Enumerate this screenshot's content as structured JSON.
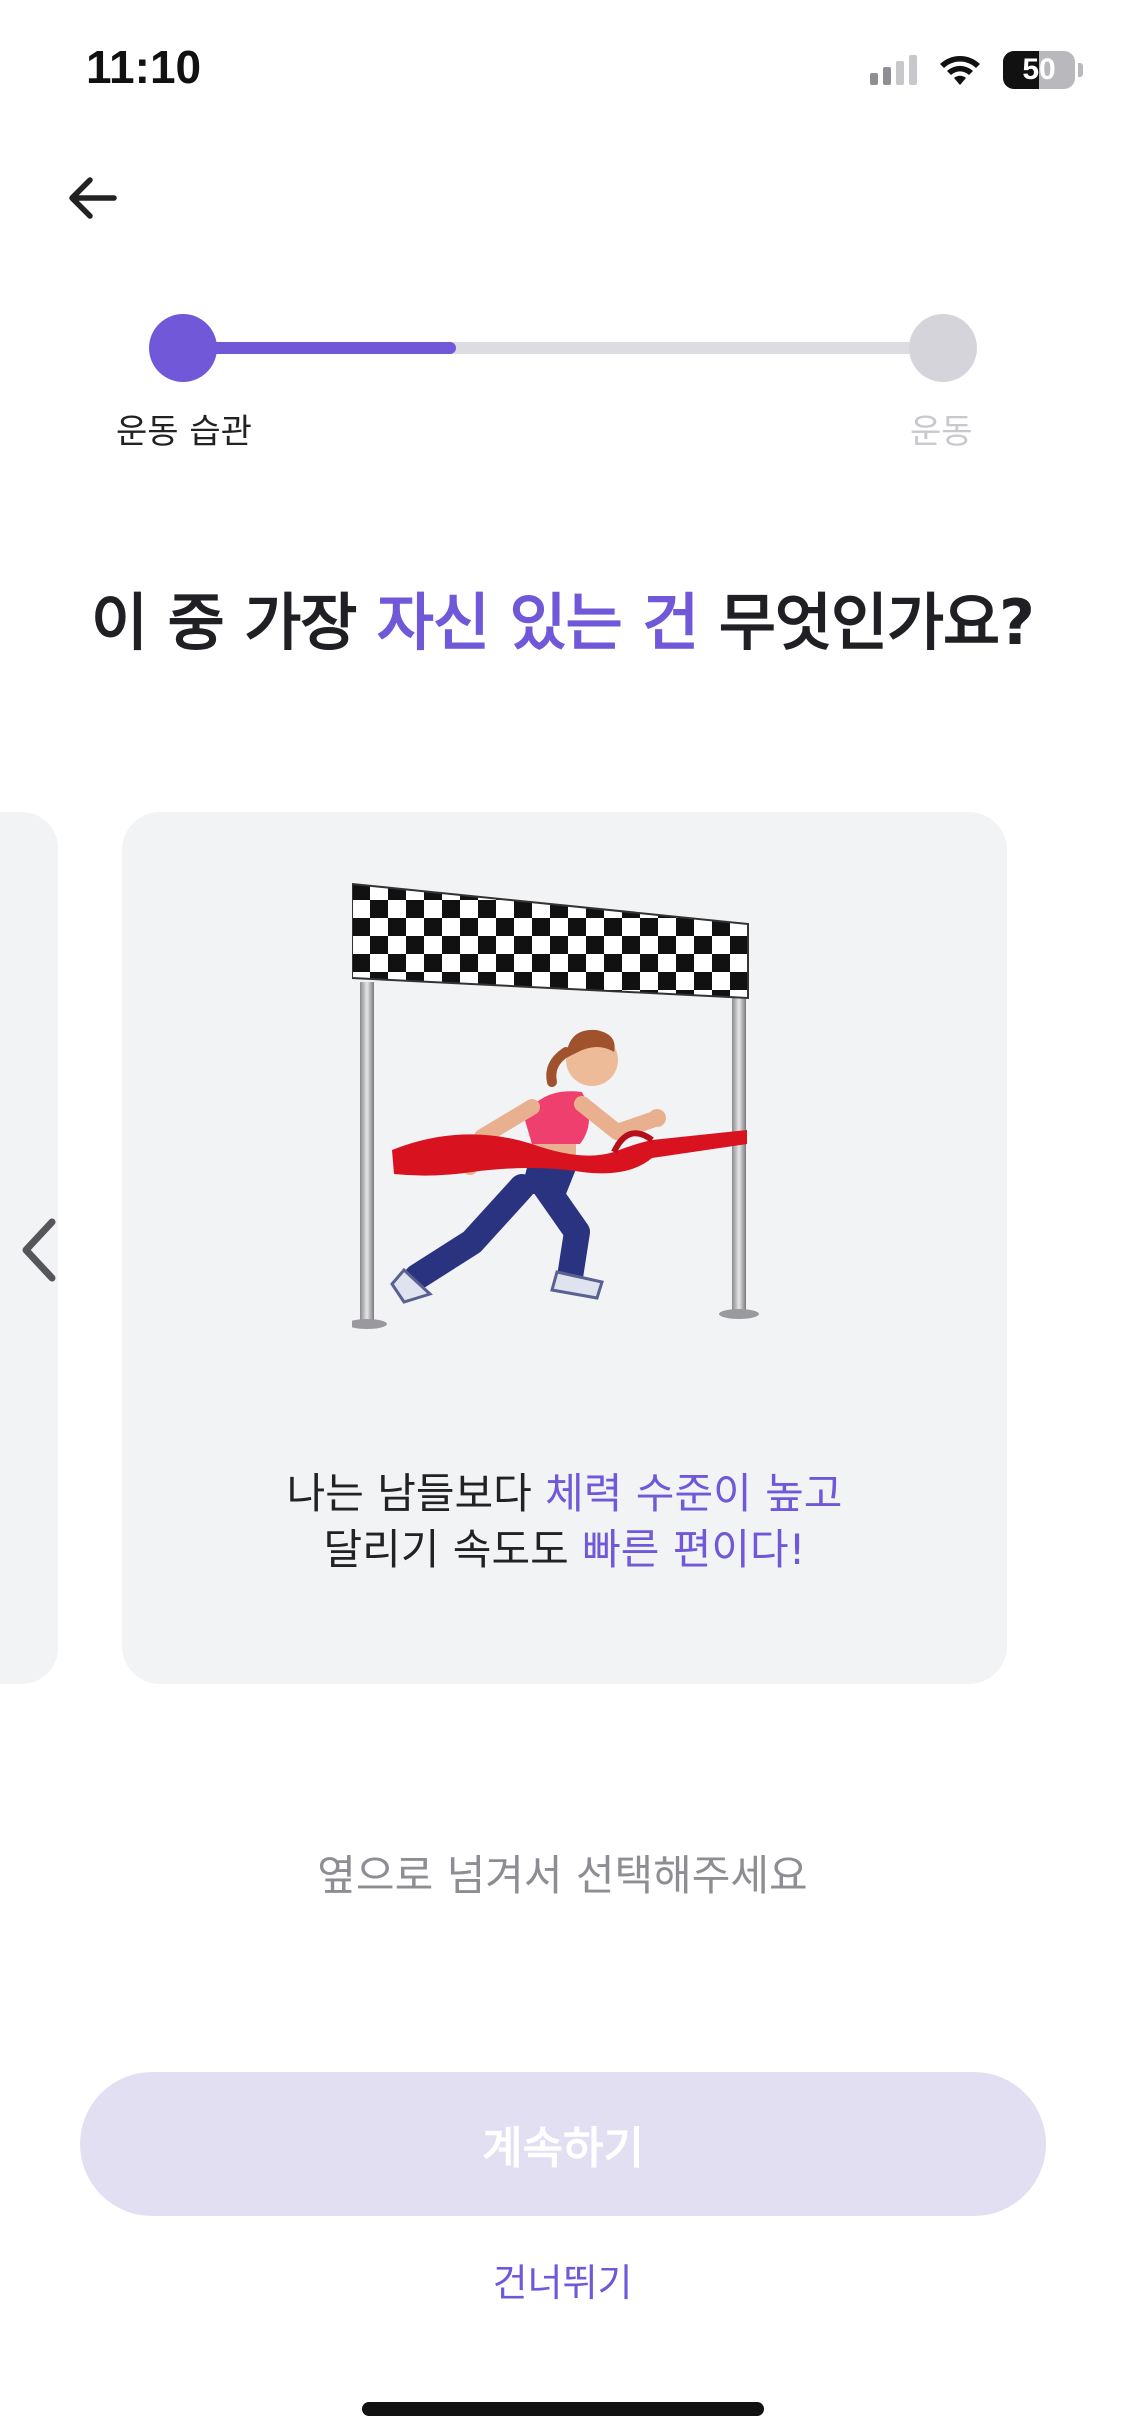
{
  "status_bar": {
    "time": "11:10",
    "battery": "50"
  },
  "progress": {
    "fill_fraction": 0.36,
    "steps": [
      {
        "label": "운동 습관",
        "state": "active"
      },
      {
        "label": "운동",
        "state": "inactive"
      }
    ]
  },
  "question": {
    "part1": "이 중 가장 ",
    "highlight": "자신 있는 건",
    "part2": " 무엇인가요?"
  },
  "card": {
    "line1_plain": "나는 남들보다 ",
    "line1_highlight": "체력 수준이 높고",
    "line2_plain": "달리기 속도도 ",
    "line2_highlight": "빠른 편이다!"
  },
  "hint": "옆으로 넘겨서 선택해주세요",
  "continue_button": "계속하기",
  "skip_link": "건너뛰기",
  "colors": {
    "accent": "#7158d9",
    "card_bg": "#f2f3f5",
    "button_disabled": "#e2dff3"
  },
  "icons": {
    "back": "arrow-left-icon",
    "prev": "chevron-left-icon"
  }
}
